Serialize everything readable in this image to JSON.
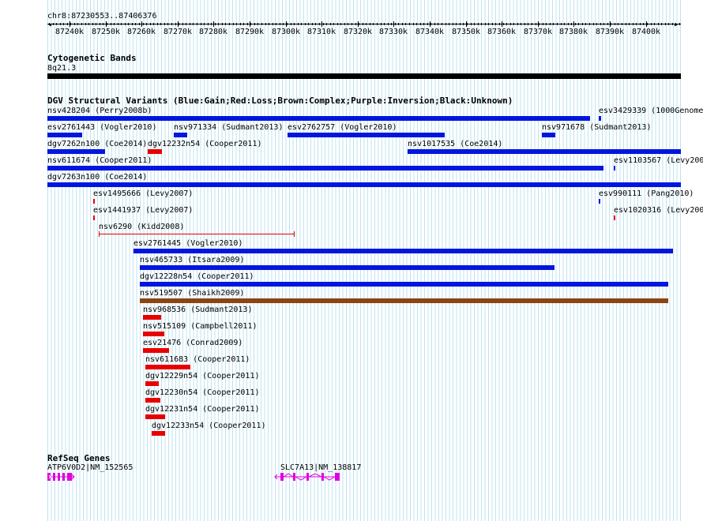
{
  "ruler": {
    "range_label": "chr8:87230553..87406376",
    "tick_labels": [
      "87240k",
      "87250k",
      "87260k",
      "87270k",
      "87280k",
      "87290k",
      "87300k",
      "87310k",
      "87320k",
      "87330k",
      "87340k",
      "87350k",
      "87360k",
      "87370k",
      "87380k",
      "87390k",
      "87400k"
    ]
  },
  "cytoband": {
    "title": "Cytogenetic Bands",
    "band_label": "8q21.3"
  },
  "dgv": {
    "title": "DGV Structural Variants (Blue:Gain;Red:Loss;Brown:Complex;Purple:Inversion;Black:Unknown)",
    "features": [
      {
        "label": "nsv428204 (Perry2008b)",
        "color": "blue"
      },
      {
        "label": "esv3429339 (1000Genome",
        "color": "blue"
      },
      {
        "label": "esv2761443 (Vogler2010)",
        "color": "blue"
      },
      {
        "label": "nsv971334 (Sudmant2013)",
        "color": "blue"
      },
      {
        "label": "esv2762757 (Vogler2010)",
        "color": "blue"
      },
      {
        "label": "nsv971678 (Sudmant2013)",
        "color": "blue"
      },
      {
        "label": "dgv7262n100 (Coe2014)",
        "color": "blue"
      },
      {
        "label": "dgv12232n54 (Cooper2011)",
        "color": "red"
      },
      {
        "label": "nsv1017535 (Coe2014)",
        "color": "blue"
      },
      {
        "label": "nsv611674 (Cooper2011)",
        "color": "blue"
      },
      {
        "label": "esv1103567 (Levy200",
        "color": "blue"
      },
      {
        "label": "dgv7263n100 (Coe2014)",
        "color": "blue"
      },
      {
        "label": "esv1495666 (Levy2007)",
        "color": "red"
      },
      {
        "label": "esv990111 (Pang2010)",
        "color": "blue"
      },
      {
        "label": "esv1441937 (Levy2007)",
        "color": "red"
      },
      {
        "label": "esv1020316 (Levy200",
        "color": "red"
      },
      {
        "label": "nsv6290 (Kidd2008)",
        "color": "red"
      },
      {
        "label": "esv2761445 (Vogler2010)",
        "color": "blue"
      },
      {
        "label": "nsv465733 (Itsara2009)",
        "color": "blue"
      },
      {
        "label": "dgv12228n54 (Cooper2011)",
        "color": "blue"
      },
      {
        "label": "nsv519507 (Shaikh2009)",
        "color": "brown"
      },
      {
        "label": "nsv968536 (Sudmant2013)",
        "color": "red"
      },
      {
        "label": "nsv515109 (Campbell2011)",
        "color": "red"
      },
      {
        "label": "esv21476 (Conrad2009)",
        "color": "red"
      },
      {
        "label": "nsv611683 (Cooper2011)",
        "color": "red"
      },
      {
        "label": "dgv12229n54 (Cooper2011)",
        "color": "red"
      },
      {
        "label": "dgv12230n54 (Cooper2011)",
        "color": "red"
      },
      {
        "label": "dgv12231n54 (Cooper2011)",
        "color": "red"
      },
      {
        "label": "dgv12233n54 (Cooper2011)",
        "color": "red"
      }
    ]
  },
  "refseq": {
    "title": "RefSeq Genes",
    "genes": [
      {
        "label": "ATP6V0D2|NM_152565"
      },
      {
        "label": "SLC7A13|NM_138817"
      }
    ]
  },
  "colors": {
    "gain": "#0016e0",
    "loss": "#e80000",
    "complex": "#8b4513",
    "gene": "#e000e0",
    "grid": "#bfe3f0"
  }
}
